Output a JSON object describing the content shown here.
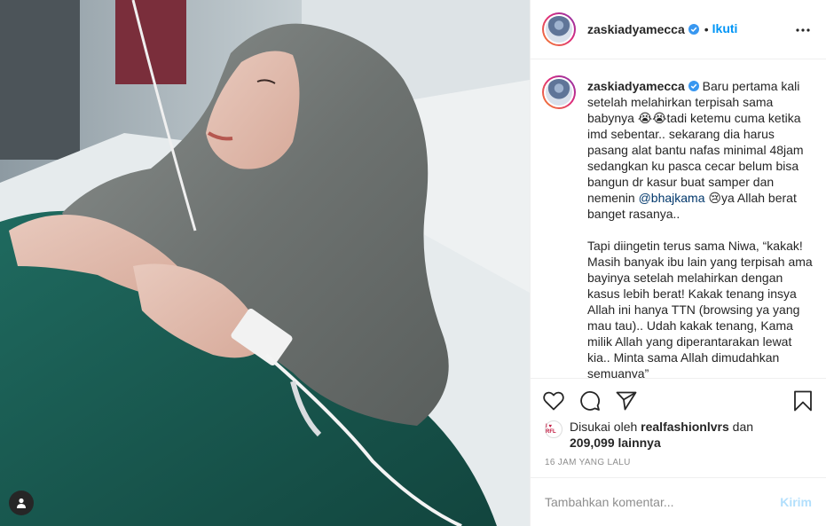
{
  "post": {
    "username": "zaskiadyamecca",
    "verified": true,
    "separator": "•",
    "follow_label": "Ikuti",
    "more_icon": "more-horizontal-icon"
  },
  "caption": {
    "username": "zaskiadyamecca",
    "paragraph1_a": "Baru pertama kali setelah melahirkan terpisah sama babynya 😭😭tadi ketemu cuma ketika imd sebentar.. sekarang dia harus pasang alat bantu nafas minimal 48jam sedangkan ku pasca cecar belum bisa bangun dr kasur buat samper dan nemenin ",
    "mention": "@bhajkama",
    "paragraph1_b": " 😢ya Allah berat banget rasanya..",
    "paragraph2": "Tapi diingetin terus sama Niwa, “kakak! Masih banyak ibu lain yang terpisah ama bayinya setelah melahirkan dengan kasus lebih berat! Kakak tenang insya Allah ini hanya TTN (browsing ya yang mau tau).. Udah kakak tenang, Kama milik Allah yang diperantarakan lewat kia.. Minta sama Allah dimudahkan semuanya”"
  },
  "actions": {
    "like_icon": "heart-icon",
    "comment_icon": "comment-icon",
    "share_icon": "paper-plane-icon",
    "save_icon": "bookmark-icon"
  },
  "likes": {
    "prefix": "Disukai oleh ",
    "liker": "realfashionlvrs",
    "middle": " dan",
    "count": "209,099",
    "suffix": " lainnya",
    "liker_avatar_text": "I ♥ RFL"
  },
  "timestamp": "16 JAM YANG LALU",
  "comment": {
    "placeholder": "Tambahkan komentar...",
    "post_label": "Kirim"
  },
  "colors": {
    "accent": "#0095f6",
    "text": "#262626",
    "muted": "#8e8e8e",
    "post_disabled": "#b2dffc",
    "mention": "#00376b"
  }
}
